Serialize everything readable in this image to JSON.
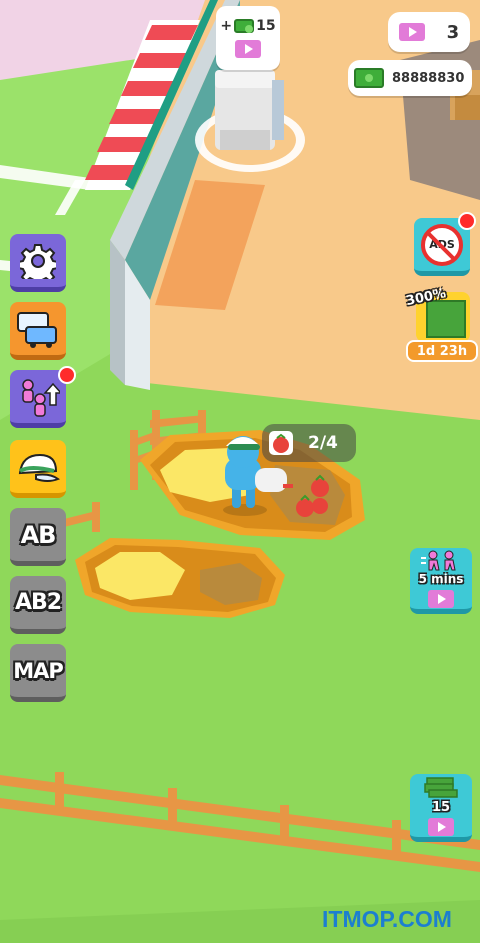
{
  "hud": {
    "ticket_count": "3",
    "cash_amount": "88888830",
    "reward_prefix": "+",
    "reward_amount": "15"
  },
  "side_menu": {
    "settings_icon": "gear-icon",
    "vehicles_icon": "truck-icon",
    "workers_icon": "workers-upgrade-icon",
    "hat_icon": "cap-icon",
    "ab_label": "AB",
    "ab2_label": "AB2",
    "map_label": "MAP"
  },
  "right_panel": {
    "no_ads_label": "ADS",
    "boost_percent": "300%",
    "boost_timer": "1d 23h",
    "speed_boost_label": "5 mins",
    "cash_stack_amount": "15"
  },
  "field": {
    "harvest_progress": "2/4"
  },
  "watermark": "ITMOP.COM",
  "colors": {
    "grass": "#8fd85a",
    "floor": "#f8c98a",
    "purple_button": "#7b67d9",
    "teal_button": "#3ec9d6",
    "notification": "#ff2b2b"
  }
}
